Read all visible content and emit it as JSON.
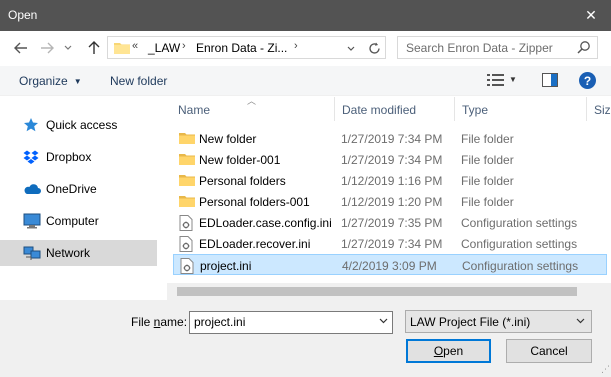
{
  "window": {
    "title": "Open",
    "close_glyph": "✕"
  },
  "nav": {
    "back_icon": "back-arrow-icon",
    "forward_icon": "forward-arrow-icon",
    "up_icon": "up-arrow-icon"
  },
  "address": {
    "overflow": "«",
    "segments": [
      "_LAW",
      "Enron Data - Zi..."
    ]
  },
  "search": {
    "placeholder": "Search Enron Data - Zipper"
  },
  "toolbar": {
    "organize": "Organize",
    "new_folder": "New folder",
    "help": "?"
  },
  "sidebar": {
    "items": [
      {
        "label": "Quick access",
        "icon": "star-icon"
      },
      {
        "label": "Dropbox",
        "icon": "dropbox-icon"
      },
      {
        "label": "OneDrive",
        "icon": "cloud-icon"
      },
      {
        "label": "Computer",
        "icon": "computer-icon"
      },
      {
        "label": "Network",
        "icon": "network-icon",
        "selected": true
      }
    ]
  },
  "columns": {
    "name": "Name",
    "date": "Date modified",
    "type": "Type",
    "size": "Size"
  },
  "files": [
    {
      "name": "New folder",
      "date": "1/27/2019 7:34 PM",
      "type": "File folder",
      "icon": "folder-icon"
    },
    {
      "name": "New folder-001",
      "date": "1/27/2019 7:34 PM",
      "type": "File folder",
      "icon": "folder-icon"
    },
    {
      "name": "Personal folders",
      "date": "1/12/2019 1:16 PM",
      "type": "File folder",
      "icon": "folder-icon"
    },
    {
      "name": "Personal folders-001",
      "date": "1/12/2019 1:20 PM",
      "type": "File folder",
      "icon": "folder-icon"
    },
    {
      "name": "EDLoader.case.config.ini",
      "date": "1/27/2019 7:35 PM",
      "type": "Configuration settings",
      "icon": "config-file-icon"
    },
    {
      "name": "EDLoader.recover.ini",
      "date": "1/27/2019 7:34 PM",
      "type": "Configuration settings",
      "icon": "config-file-icon"
    },
    {
      "name": "project.ini",
      "date": "4/2/2019 3:09 PM",
      "type": "Configuration settings",
      "icon": "config-file-icon",
      "selected": true
    }
  ],
  "footer": {
    "file_name_label_prefix": "File ",
    "file_name_label_accel": "n",
    "file_name_label_suffix": "ame:",
    "file_name_value": "project.ini",
    "file_type_value": "LAW Project File (*.ini)",
    "open_accel": "O",
    "open_rest": "pen",
    "cancel": "Cancel"
  },
  "colors": {
    "selection": "#cce8ff",
    "accent": "#0078d7",
    "titlebar": "#535353"
  }
}
